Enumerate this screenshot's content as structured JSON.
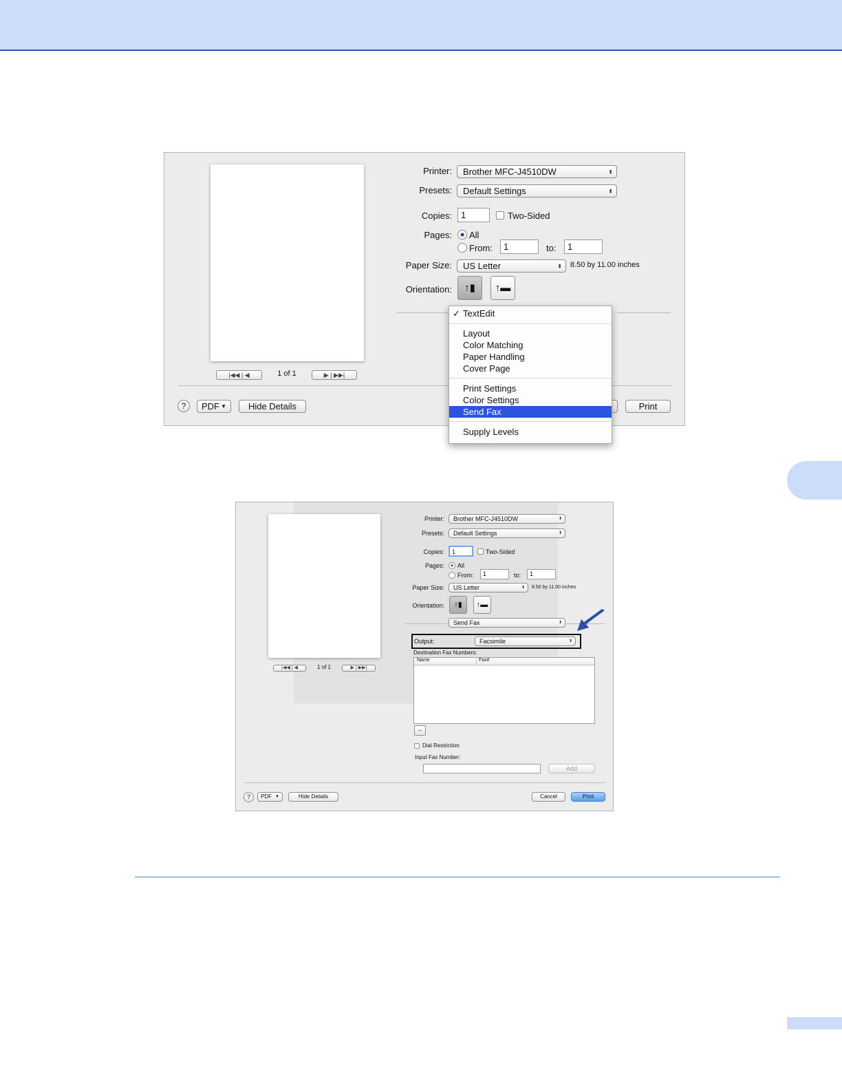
{
  "dialog1": {
    "printer_label": "Printer:",
    "printer_value": "Brother MFC-J4510DW",
    "presets_label": "Presets:",
    "presets_value": "Default Settings",
    "copies_label": "Copies:",
    "copies_value": "1",
    "two_sided_label": "Two-Sided",
    "pages_label": "Pages:",
    "pages_all_label": "All",
    "pages_from_label": "From:",
    "pages_from_value": "1",
    "pages_to_label": "to:",
    "pages_to_value": "1",
    "paper_size_label": "Paper Size:",
    "paper_size_value": "US Letter",
    "paper_size_dims": "8.50 by 11.00 inches",
    "orientation_label": "Orientation:",
    "page_counter": "1 of 1",
    "help_label": "?",
    "pdf_label": "PDF",
    "hide_details_label": "Hide Details",
    "print_label": "Print",
    "menu": {
      "checked_item": "TextEdit",
      "group1": [
        "Layout",
        "Color Matching",
        "Paper Handling",
        "Cover Page"
      ],
      "group2": [
        "Print Settings",
        "Color Settings"
      ],
      "highlighted_item": "Send Fax",
      "group3": [
        "Supply Levels"
      ]
    }
  },
  "dialog2": {
    "printer_label": "Printer:",
    "printer_value": "Brother MFC-J4510DW",
    "presets_label": "Presets:",
    "presets_value": "Default Settings",
    "copies_label": "Copies:",
    "copies_value": "1",
    "two_sided_label": "Two-Sided",
    "pages_label": "Pages:",
    "pages_all_label": "All",
    "pages_from_label": "From:",
    "pages_from_value": "1",
    "pages_to_label": "to:",
    "pages_to_value": "1",
    "paper_size_label": "Paper Size:",
    "paper_size_value": "US Letter",
    "paper_size_dims": "8.50 by 11.00 inches",
    "orientation_label": "Orientation:",
    "pane_value": "Send Fax",
    "output_label": "Output:",
    "output_value": "Facsimile",
    "destination_label": "Destination Fax Numbers:",
    "col_name": "Name",
    "col_fax": "Fax#",
    "remove_label": "–",
    "dial_restriction_label": "Dial Restriction",
    "input_fax_label": "Input Fax Number:",
    "add_label": "Add",
    "page_counter": "1 of 1",
    "help_label": "?",
    "pdf_label": "PDF",
    "hide_details_label": "Hide Details",
    "cancel_label": "Cancel",
    "print_label": "Print"
  },
  "colors": {
    "header_band": "#ccdcfb",
    "rule": "#2f57a8",
    "menu_highlight": "#2b54e1",
    "arrow": "#2b4fa3"
  }
}
